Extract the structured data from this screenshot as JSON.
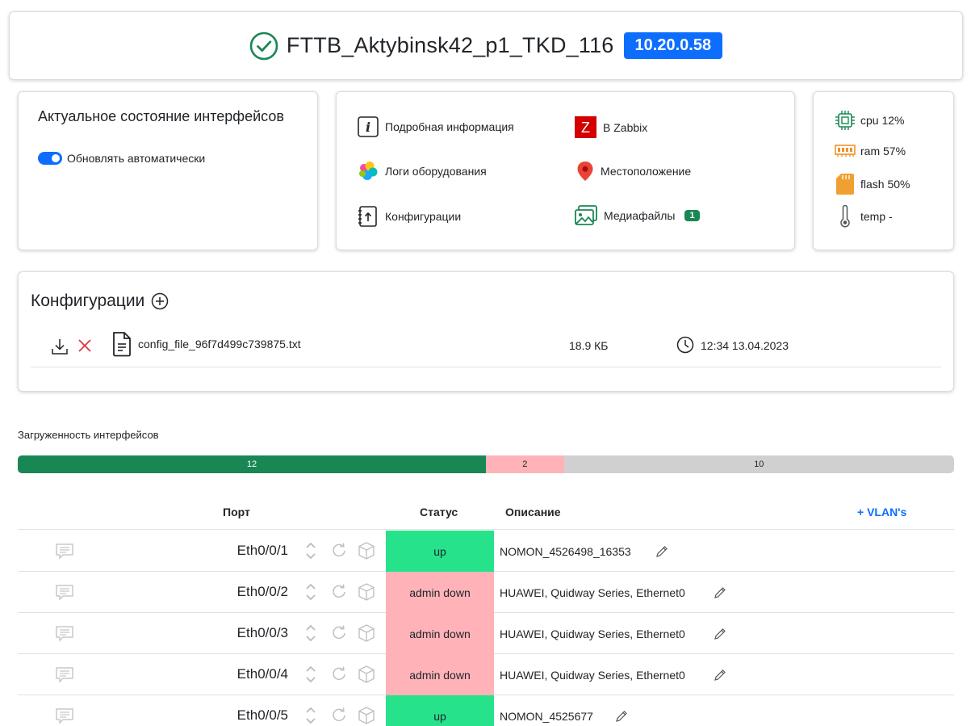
{
  "device": {
    "name": "FTTB_Aktybinsk42_p1_TKD_116",
    "ip": "10.20.0.58"
  },
  "interface_state": {
    "title": "Актуальное состояние интерфейсов",
    "auto_update_label": "Обновлять автоматически",
    "auto_update_on": true
  },
  "links": {
    "details": "Подробная информация",
    "zabbix": "В Zabbix",
    "logs": "Логи оборудования",
    "location": "Местоположение",
    "configs": "Конфигурации",
    "media": "Медиафайлы",
    "media_count": "1"
  },
  "resources": {
    "cpu": "cpu 12%",
    "ram": "ram 57%",
    "flash": "flash 50%",
    "temp": "temp -"
  },
  "configs": {
    "title": "Конфигурации",
    "files": [
      {
        "name": "config_file_96f7d499c739875.txt",
        "size": "18.9 КБ",
        "date": "12:34 13.04.2023"
      }
    ]
  },
  "load": {
    "label": "Загруженность интерфейсов",
    "segments": [
      {
        "value": 12,
        "label": "12",
        "color": "#198754",
        "text_color": "#ffffff"
      },
      {
        "value": 2,
        "label": "2",
        "color": "#ffb3b8",
        "text_color": "#212529"
      },
      {
        "value": 10,
        "label": "10",
        "color": "#d0d0d0",
        "text_color": "#212529"
      }
    ]
  },
  "table": {
    "col_port": "Порт",
    "col_status": "Статус",
    "col_desc": "Описание",
    "vlans_link": "+ VLAN's",
    "rows": [
      {
        "port": "Eth0/0/1",
        "status": "up",
        "desc": "NOMON_4526498_16353"
      },
      {
        "port": "Eth0/0/2",
        "status": "admin down",
        "desc": "HUAWEI, Quidway Series, Ethernet0"
      },
      {
        "port": "Eth0/0/3",
        "status": "admin down",
        "desc": "HUAWEI, Quidway Series, Ethernet0"
      },
      {
        "port": "Eth0/0/4",
        "status": "admin down",
        "desc": "HUAWEI, Quidway Series, Ethernet0"
      },
      {
        "port": "Eth0/0/5",
        "status": "up",
        "desc": "NOMON_4525677"
      }
    ]
  },
  "colors": {
    "status_up": "#26e38b",
    "status_admin_down": "#ffb3b8",
    "accent": "#0d6efd"
  }
}
